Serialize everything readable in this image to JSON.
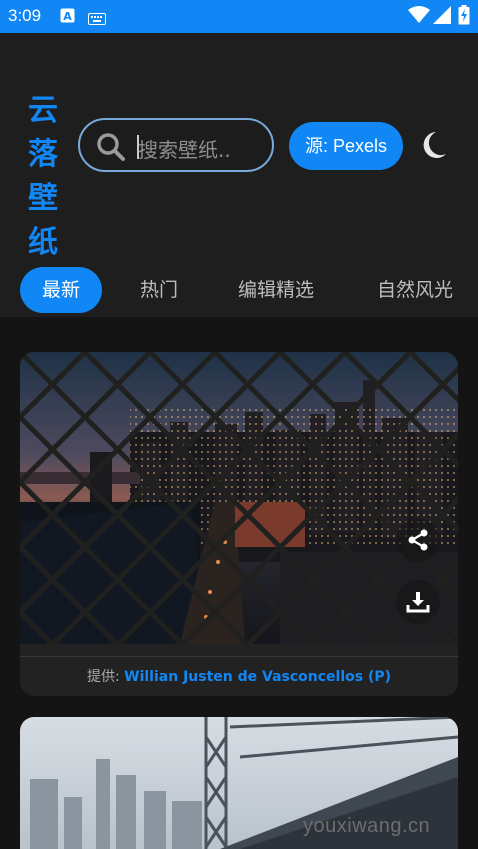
{
  "status_bar": {
    "time": "3:09"
  },
  "header": {
    "logo_chars": [
      "云",
      "落",
      "壁",
      "纸"
    ],
    "search_placeholder": "搜索壁纸..",
    "source_button": "源: Pexels"
  },
  "tabs": [
    {
      "label": "最新",
      "active": true
    },
    {
      "label": "热门",
      "active": false
    },
    {
      "label": "编辑精选",
      "active": false
    },
    {
      "label": "自然风光",
      "active": false
    }
  ],
  "cards": [
    {
      "credit_prefix": "提供: ",
      "author": "Willian Justen de Vasconcellos (P)"
    }
  ],
  "watermark": "youxiwang.cn",
  "colors": {
    "accent": "#1187f5",
    "background": "#141414",
    "surface": "#1e1e1e",
    "card": "#222222"
  }
}
